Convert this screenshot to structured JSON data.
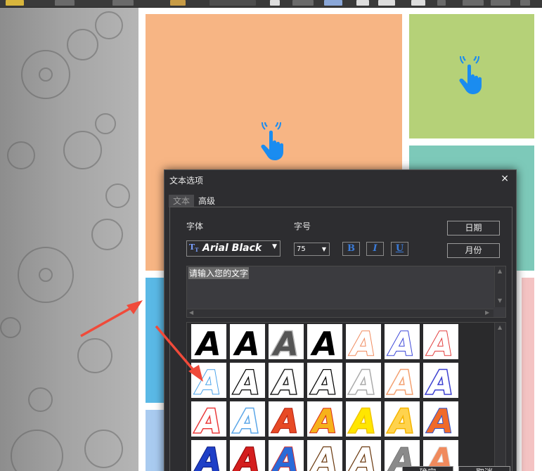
{
  "dialog": {
    "title": "文本选项",
    "close_label": "×",
    "tabs": [
      {
        "label": "文本",
        "active": true
      },
      {
        "label": "高级",
        "active": false
      }
    ],
    "font_label": "字体",
    "size_label": "字号",
    "font_value": "Arial Black",
    "size_value": "75",
    "bold_label": "B",
    "italic_label": "I",
    "underline_label": "U",
    "date_button": "日期",
    "month_button": "月份",
    "text_value": "请输入您的文字",
    "ok_button": "确定",
    "cancel_button": "取消"
  },
  "canvas_tiles": [
    {
      "name": "tile-orange",
      "color": "#f7b584"
    },
    {
      "name": "tile-green",
      "color": "#b5d178"
    },
    {
      "name": "tile-teal",
      "color": "#7dc9b9"
    },
    {
      "name": "tile-blue",
      "color": "#5ab9e6"
    },
    {
      "name": "tile-pink",
      "color": "#f4c3c3"
    },
    {
      "name": "tile-lightblue",
      "color": "#a9cbf0"
    }
  ],
  "icons": {
    "pointer": "hand-pointer-icon",
    "font": "truetype-icon"
  },
  "text_styles": [
    [
      "black-fill",
      "black-plain",
      "grey-outline",
      "black-italic",
      "orange-outline",
      "blue-outline",
      "red-outline"
    ],
    [
      "blue-light",
      "black-outline",
      "black-glow",
      "black-outline-2",
      "grey-glow",
      "orange-glow",
      "blue-glow"
    ],
    [
      "red-glow",
      "blue-glow-2",
      "red-orange",
      "orange-yellow",
      "yellow-glow",
      "gold-glow",
      "orange-blue"
    ],
    [
      "blue-dark",
      "red-dark",
      "blue-red",
      "brown-outline",
      "brown-outline-2",
      "grey-fill",
      "orange-light"
    ]
  ],
  "colors": {
    "dialog_bg": "#2d2d30",
    "accent_blue": "#1a8cf0",
    "arrow_red": "#f04a3a"
  }
}
